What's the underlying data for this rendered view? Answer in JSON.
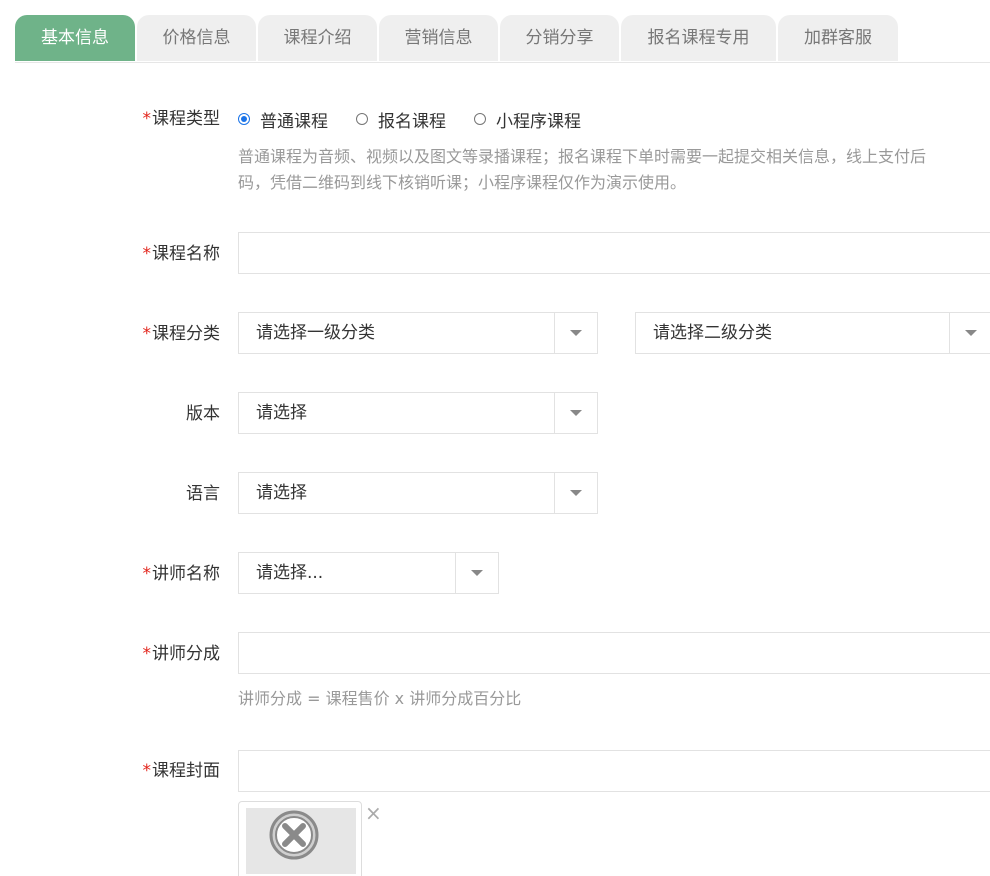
{
  "tabs": [
    {
      "label": "基本信息",
      "active": true
    },
    {
      "label": "价格信息"
    },
    {
      "label": "课程介绍"
    },
    {
      "label": "营销信息"
    },
    {
      "label": "分销分享"
    },
    {
      "label": "报名课程专用"
    },
    {
      "label": "加群客服"
    }
  ],
  "required_mark": "*",
  "form": {
    "course_type": {
      "label": "课程类型",
      "options": [
        "普通课程",
        "报名课程",
        "小程序课程"
      ],
      "selected": "普通课程",
      "help_line1": "普通课程为音频、视频以及图文等录播课程；报名课程下单时需要一起提交相关信息，线上支付后",
      "help_line2": "码，凭借二维码到线下核销听课；小程序课程仅作为演示使用。"
    },
    "course_name": {
      "label": "课程名称",
      "value": ""
    },
    "course_category": {
      "label": "课程分类",
      "primary_placeholder": "请选择一级分类",
      "secondary_placeholder": "请选择二级分类"
    },
    "version": {
      "label": "版本",
      "placeholder": "请选择"
    },
    "language": {
      "label": "语言",
      "placeholder": "请选择"
    },
    "teacher_name": {
      "label": "讲师名称",
      "placeholder": "请选择..."
    },
    "teacher_share": {
      "label": "讲师分成",
      "value": "",
      "help": "讲师分成 = 课程售价 x 讲师分成百分比"
    },
    "course_cover": {
      "label": "课程封面",
      "value": "",
      "remove_glyph": "×"
    }
  },
  "colors": {
    "active_tab": "#6fb389",
    "tab_bg": "#efefef",
    "required": "#e2231a",
    "radio_checked": "#1a73e8"
  }
}
